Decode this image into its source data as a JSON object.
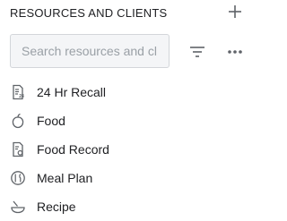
{
  "header": {
    "title": "RESOURCES AND CLIENTS",
    "add_icon": "plus-icon"
  },
  "search": {
    "placeholder": "Search resources and cl",
    "value": ""
  },
  "toolbar": {
    "filter_icon": "filter-icon",
    "more_icon": "more-horizontal-icon"
  },
  "resources": [
    {
      "label": "24 Hr Recall",
      "icon": "recall-document-icon"
    },
    {
      "label": "Food",
      "icon": "food-icon"
    },
    {
      "label": "Food Record",
      "icon": "food-record-icon"
    },
    {
      "label": "Meal Plan",
      "icon": "meal-plan-icon"
    },
    {
      "label": "Recipe",
      "icon": "recipe-icon"
    }
  ],
  "colors": {
    "text": "#202124",
    "icon": "#5f6368",
    "placeholder": "#9aa0a6",
    "input_background": "#f4f5f7",
    "input_border": "#d3d6da"
  }
}
